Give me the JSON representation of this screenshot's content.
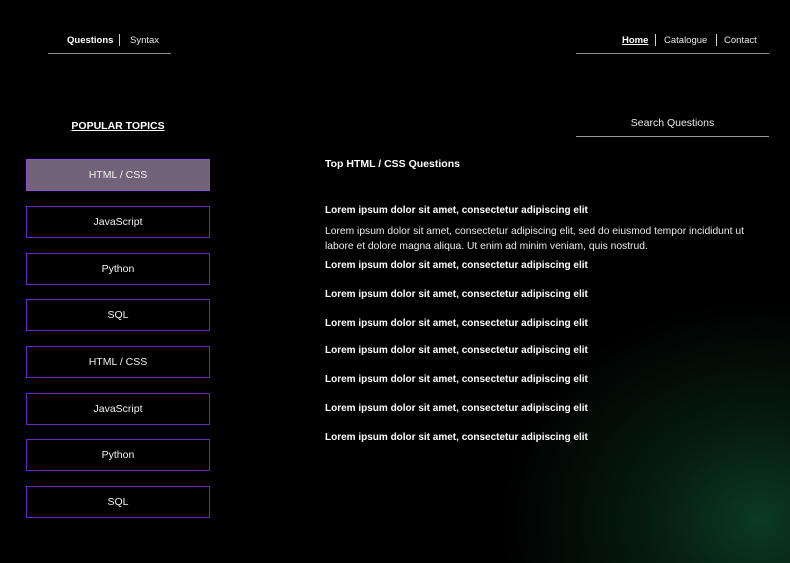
{
  "nav_left": {
    "items": [
      "Questions",
      "Syntax"
    ]
  },
  "nav_right": {
    "items": [
      "Home",
      "Catalogue",
      "Contact"
    ]
  },
  "sidebar": {
    "title": "POPULAR TOPICS",
    "topics": [
      "HTML / CSS",
      "JavaScript",
      "Python",
      "SQL",
      "HTML / CSS",
      "JavaScript",
      "Python",
      "SQL"
    ],
    "active_index": 0
  },
  "search": {
    "label": "Search Questions"
  },
  "main": {
    "title": "Top HTML / CSS Questions",
    "questions": [
      "Lorem ipsum dolor sit amet, consectetur adipiscing elit",
      "Lorem ipsum dolor sit amet, consectetur adipiscing elit",
      "Lorem ipsum dolor sit amet, consectetur adipiscing elit",
      "Lorem ipsum dolor sit amet, consectetur adipiscing elit",
      "Lorem ipsum dolor sit amet, consectetur adipiscing elit",
      "Lorem ipsum dolor sit amet, consectetur adipiscing elit",
      "Lorem ipsum dolor sit amet, consectetur adipiscing elit",
      "Lorem ipsum dolor sit amet, consectetur adipiscing elit"
    ],
    "expanded_answer": "Lorem ipsum dolor sit amet, consectetur adipiscing elit, sed do eiusmod tempor incididunt ut labore et dolore magna aliqua. Ut enim ad minim veniam, quis nostrud."
  },
  "colors": {
    "accent": "#6a24c4",
    "active_topic_bg": "#726278",
    "background": "#000000",
    "glow": "#0b3a22"
  }
}
